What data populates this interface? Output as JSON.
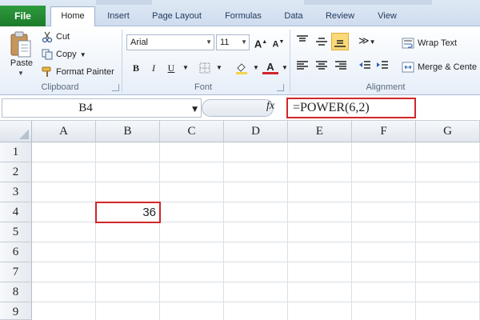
{
  "ribbon_tabs": {
    "file": "File",
    "home": "Home",
    "insert": "Insert",
    "page_layout": "Page Layout",
    "formulas": "Formulas",
    "data": "Data",
    "review": "Review",
    "view": "View"
  },
  "clipboard": {
    "paste": "Paste",
    "cut": "Cut",
    "copy": "Copy",
    "format_painter": "Format Painter",
    "label": "Clipboard"
  },
  "font": {
    "name": "Arial",
    "size": "11",
    "bold": "B",
    "italic": "I",
    "underline": "U",
    "label": "Font",
    "font_color": "#d0262b",
    "fill_color": "#f3d34a"
  },
  "alignment": {
    "wrap_text": "Wrap Text",
    "merge_center": "Merge & Cente",
    "label": "Alignment"
  },
  "formula_bar": {
    "name_box": "B4",
    "fx": "fx",
    "formula": "=POWER(6,2)"
  },
  "grid": {
    "columns": [
      "A",
      "B",
      "C",
      "D",
      "E",
      "F",
      "G"
    ],
    "rows": [
      "1",
      "2",
      "3",
      "4",
      "5",
      "6",
      "7",
      "8",
      "9"
    ],
    "cell_b4": "36"
  },
  "highlight_color": "#d0262b"
}
